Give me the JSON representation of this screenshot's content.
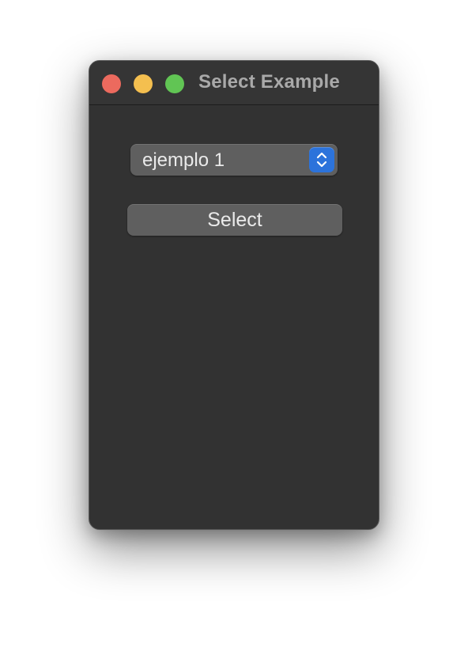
{
  "window": {
    "title": "Select Example",
    "controls": {
      "close_color": "#ec6a5e",
      "minimize_color": "#f4bf4f",
      "zoom_color": "#61c554"
    }
  },
  "select": {
    "value": "ejemplo 1",
    "stepper_color": "#2c73db",
    "stepper_icon": "up-down-chevron-icon"
  },
  "button": {
    "label": "Select"
  }
}
